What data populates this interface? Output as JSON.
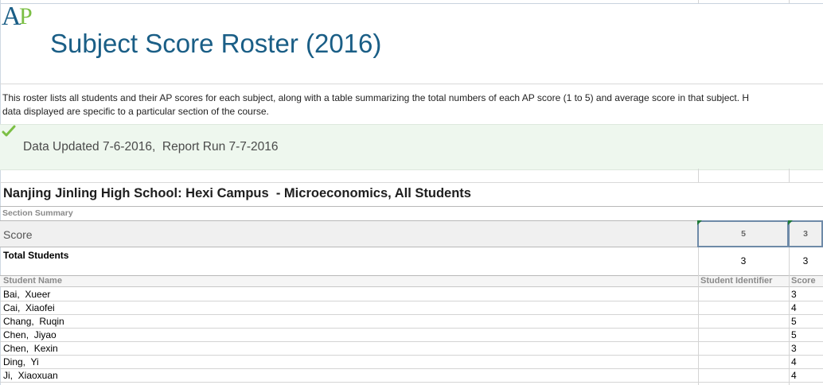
{
  "logo": {
    "text_a": "A",
    "text_p": "P",
    "color_a": "#1a5e86",
    "color_p": "#7bbf44"
  },
  "page_title": "Subject Score Roster (2016)",
  "description": {
    "line1": "This roster lists all students and their AP scores for each subject, along with a table summarizing the total numbers of each AP score (1 to 5) and average score in that subject. H",
    "line2": "data displayed are specific to a particular section of the course."
  },
  "status": {
    "icon": "checkmark-icon",
    "text": "Data Updated 7-6-2016,  Report Run 7-7-2016"
  },
  "section_title": "Nanjing Jinling High School: Hexi Campus  - Microeconomics, All Students",
  "section_summary": {
    "label": "Section Summary",
    "score_label": "Score",
    "score_columns": [
      "5",
      "3"
    ],
    "total_label": "Total Students",
    "totals": [
      "3",
      "3"
    ]
  },
  "roster": {
    "columns": [
      "Student Name",
      "Student Identifier",
      "Score"
    ],
    "rows": [
      {
        "name": "Bai,  Xueer",
        "id": "",
        "score": "3"
      },
      {
        "name": "Cai,  Xiaofei",
        "id": "",
        "score": "4"
      },
      {
        "name": "Chang,  Ruqin",
        "id": "",
        "score": "5"
      },
      {
        "name": "Chen,  Jiyao",
        "id": "",
        "score": "5"
      },
      {
        "name": "Chen,  Kexin",
        "id": "",
        "score": "3"
      },
      {
        "name": "Ding,  Yi",
        "id": "",
        "score": "4"
      },
      {
        "name": "Ji,  Xiaoxuan",
        "id": "",
        "score": "4"
      }
    ]
  }
}
